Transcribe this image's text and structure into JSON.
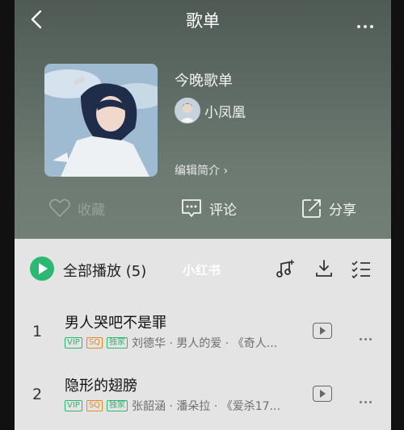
{
  "topbar": {
    "title": "歌单",
    "back_icon": "chevron-left-icon",
    "more_icon": "more-horizontal-icon"
  },
  "playlist": {
    "name": "今晚歌单",
    "creator": "小凤凰",
    "intro_link": "编辑简介 ›"
  },
  "actions": {
    "favorite": "收藏",
    "comment": "评论",
    "share": "分享"
  },
  "list_header": {
    "play_all": "全部播放 (5)",
    "watermark": "小红书"
  },
  "songs": [
    {
      "index": "1",
      "title": "男人哭吧不是罪",
      "badges": [
        "VIP",
        "SQ",
        "独家"
      ],
      "meta": "刘德华 · 男人的爱 · 《奇人..."
    },
    {
      "index": "2",
      "title": "隐形的翅膀",
      "badges": [
        "VIP",
        "SQ",
        "独家"
      ],
      "meta": "张韶涵 · 潘朵拉 · 《爱杀17..."
    }
  ],
  "colors": {
    "accent": "#2bb872",
    "sq_badge": "#e58a23",
    "header_bg": "#5d6a63",
    "list_bg": "#e4e4e4"
  }
}
